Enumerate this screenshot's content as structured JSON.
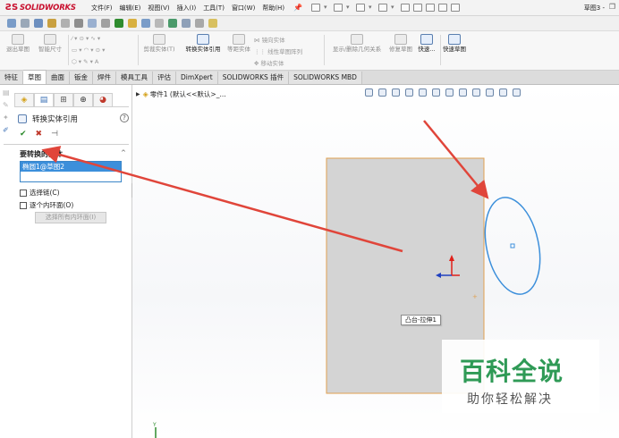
{
  "app": {
    "logo": "SOLIDWORKS",
    "document_title": "草图3 -"
  },
  "menu": {
    "items": [
      "文件(F)",
      "编辑(E)",
      "视图(V)",
      "插入(I)",
      "工具(T)",
      "窗口(W)",
      "帮助(H)"
    ]
  },
  "command_manager": {
    "exit_sketch": "退出草图",
    "smart_dimension": "智能尺寸",
    "trim_entities": "剪裁实体(T)",
    "convert_entities": "转换实体引用",
    "offset_entities": "等距实体",
    "mirror_entities": "镜向实体",
    "linear_pattern": "线性草图阵列",
    "move_entities": "移动实体",
    "display_relations": "显示/删除几何关系",
    "repair_sketch": "修复草图",
    "quick_snaps": "快速...",
    "rapid_sketch": "快速草图"
  },
  "tabs": [
    "特征",
    "草图",
    "曲面",
    "钣金",
    "焊件",
    "模具工具",
    "评估",
    "DimXpert",
    "SOLIDWORKS 插件",
    "SOLIDWORKS MBD"
  ],
  "active_tab_index": 1,
  "property_manager": {
    "title": "转换实体引用",
    "help": "?",
    "ok": "✔",
    "cancel": "✖",
    "pushpin": "⊣",
    "section_title": "要转换的实体",
    "collapse": "^",
    "list_item": "椭圆1@草图2",
    "select_chain": "选择链(C)",
    "inner_loops": "逐个内环面(O)",
    "select_all_inner": "选择所有内环面(I)"
  },
  "graphics": {
    "tree_flyout": "零件1  (默认<<默认>_...",
    "feature_tip": "凸台-拉伸1",
    "face_color": "#d4d4d4",
    "face_border_color": "#e0a050",
    "ellipse_color": "#3c8fdb",
    "arrow_color": "#e0453a",
    "triad_y_color": "#e0201a",
    "triad_x_color": "#2040c0"
  },
  "watermark": {
    "title": "百科全说",
    "subtitle": "助你轻松解决",
    "color": "#2f9a56"
  }
}
